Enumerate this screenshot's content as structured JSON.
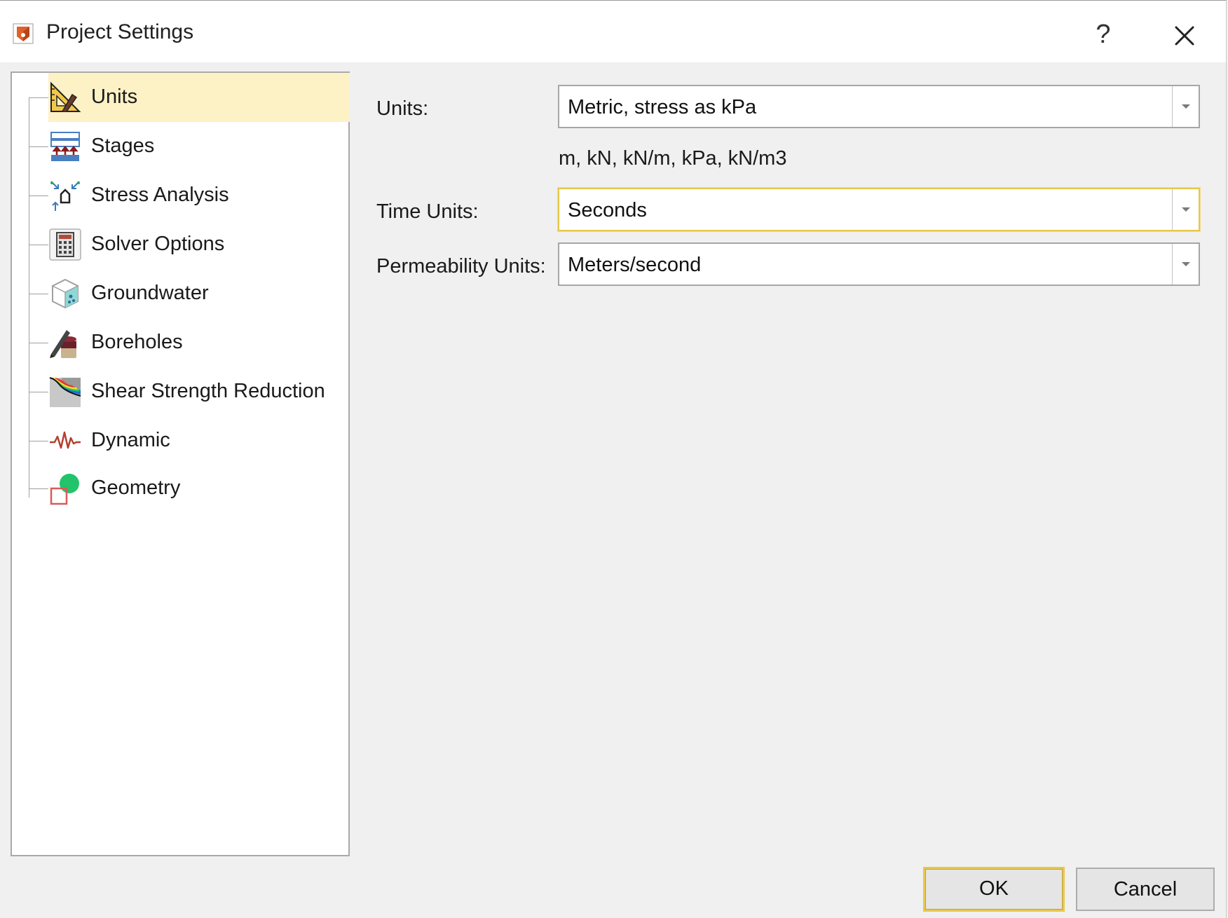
{
  "window": {
    "title": "Project Settings",
    "help_glyph": "?",
    "icons": {
      "app": "app-icon",
      "help": "help-icon",
      "close": "close-icon"
    }
  },
  "tree": {
    "selected_index": 0,
    "items": [
      {
        "label": "Units",
        "icon": "set-square-ruler-icon"
      },
      {
        "label": "Stages",
        "icon": "stages-icon"
      },
      {
        "label": "Stress Analysis",
        "icon": "stress-analysis-icon"
      },
      {
        "label": "Solver Options",
        "icon": "calculator-icon"
      },
      {
        "label": "Groundwater",
        "icon": "groundwater-cube-icon"
      },
      {
        "label": "Boreholes",
        "icon": "borehole-icon"
      },
      {
        "label": "Shear Strength Reduction",
        "icon": "shear-strength-reduction-icon"
      },
      {
        "label": "Dynamic",
        "icon": "dynamic-wave-icon"
      },
      {
        "label": "Geometry",
        "icon": "geometry-icon"
      }
    ]
  },
  "units_page": {
    "units_label": "Units:",
    "units_value": "Metric, stress as kPa",
    "units_description": "m, kN, kN/m, kPa, kN/m3",
    "time_units_label": "Time Units:",
    "time_units_value": "Seconds",
    "permeability_units_label": "Permeability Units:",
    "permeability_units_value": "Meters/second"
  },
  "buttons": {
    "ok": "OK",
    "cancel": "Cancel"
  },
  "colors": {
    "selection_bg": "#fdf1c6",
    "focus_border": "#e8c74a",
    "panel_border": "#a9a9a9",
    "dialog_bg": "#f0f0f0"
  }
}
